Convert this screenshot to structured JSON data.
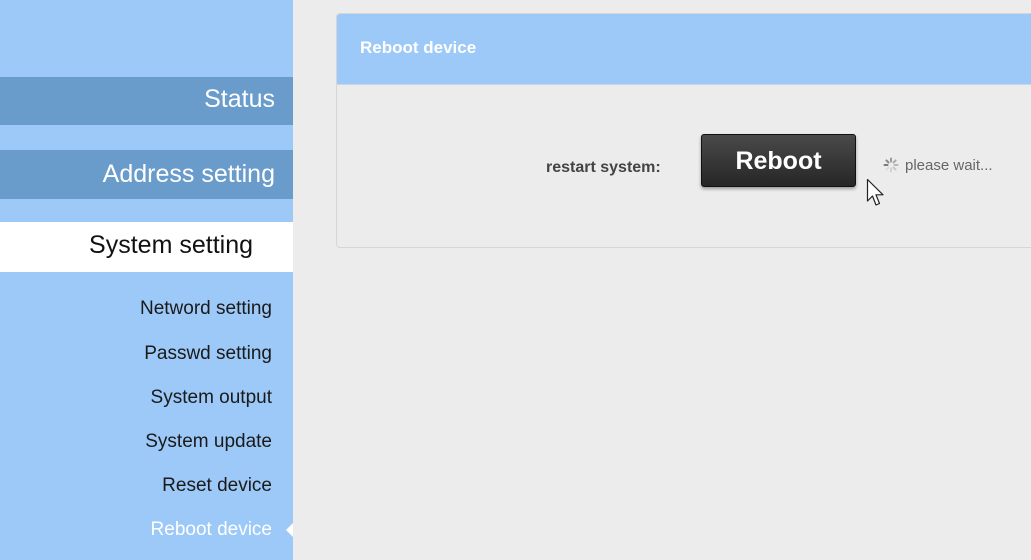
{
  "sidebar": {
    "main_items": [
      {
        "label": "Status"
      },
      {
        "label": "Address setting"
      },
      {
        "label": "System setting"
      }
    ],
    "sub_items": [
      {
        "label": "Netword setting"
      },
      {
        "label": "Passwd setting"
      },
      {
        "label": "System output"
      },
      {
        "label": "System update"
      },
      {
        "label": "Reset device"
      },
      {
        "label": "Reboot device"
      }
    ],
    "active_item": "Reboot device"
  },
  "panel": {
    "title": "Reboot device",
    "restart_label": "restart system:",
    "reboot_button": "Reboot",
    "status_text": "please wait..."
  },
  "colors": {
    "sidebar_bg": "#9cc9f7",
    "sidebar_main_item_bg": "#6a9ccb",
    "selected_bg": "#ffffff",
    "button_bg": "#2e2e2e",
    "page_bg": "#ececec"
  },
  "icons": {
    "spinner": "loading-spinner-icon",
    "cursor": "mouse-pointer-icon",
    "active_marker": "triangle-left-icon"
  }
}
